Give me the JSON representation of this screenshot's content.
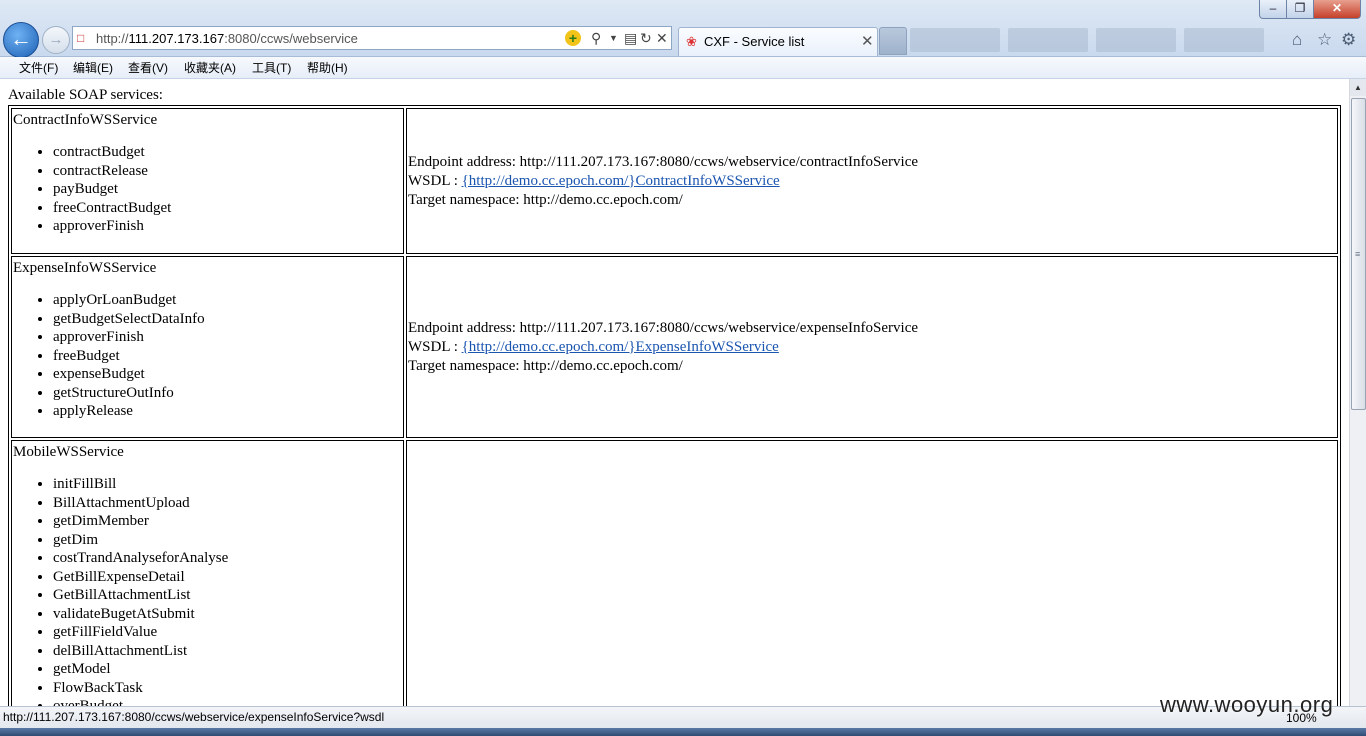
{
  "browser": {
    "url_prefix": "http://",
    "url_host": "111.207.173.167",
    "url_rest": ":8080/ccws/webservice",
    "tab_title": "CXF - Service list"
  },
  "menu": [
    "文件(F)",
    "编辑(E)",
    "查看(V)",
    "收藏夹(A)",
    "工具(T)",
    "帮助(H)"
  ],
  "page": {
    "heading": "Available SOAP services:",
    "services": [
      {
        "name": "ContractInfoWSService",
        "operations": [
          "contractBudget",
          "contractRelease",
          "payBudget",
          "freeContractBudget",
          "approverFinish"
        ],
        "endpoint_label": "Endpoint address: ",
        "endpoint": "http://111.207.173.167:8080/ccws/webservice/contractInfoService",
        "wsdl_label": "WSDL : ",
        "wsdl": "{http://demo.cc.epoch.com/}ContractInfoWSService",
        "namespace_label": "Target namespace: ",
        "namespace": "http://demo.cc.epoch.com/"
      },
      {
        "name": "ExpenseInfoWSService",
        "operations": [
          "applyOrLoanBudget",
          "getBudgetSelectDataInfo",
          "approverFinish",
          "freeBudget",
          "expenseBudget",
          "getStructureOutInfo",
          "applyRelease"
        ],
        "endpoint_label": "Endpoint address: ",
        "endpoint": "http://111.207.173.167:8080/ccws/webservice/expenseInfoService",
        "wsdl_label": "WSDL : ",
        "wsdl": "{http://demo.cc.epoch.com/}ExpenseInfoWSService",
        "namespace_label": "Target namespace: ",
        "namespace": "http://demo.cc.epoch.com/"
      },
      {
        "name": "MobileWSService",
        "operations": [
          "initFillBill",
          "BillAttachmentUpload",
          "getDimMember",
          "getDim",
          "costTrandAnalyseforAnalyse",
          "GetBillExpenseDetail",
          "GetBillAttachmentList",
          "validateBugetAtSubmit",
          "getFillFieldValue",
          "delBillAttachmentList",
          "getModel",
          "FlowBackTask",
          "overBudget"
        ]
      }
    ]
  },
  "status": {
    "text": "http://111.207.173.167:8080/ccws/webservice/expenseInfoService?wsdl",
    "zoom": "100%",
    "watermark": "www.wooyun.org"
  }
}
